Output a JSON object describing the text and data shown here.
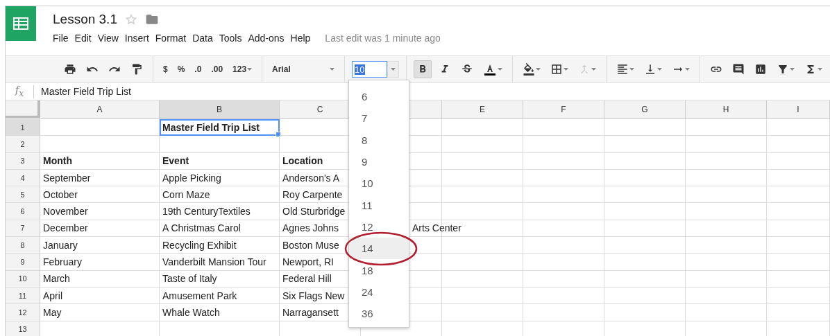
{
  "document": {
    "title": "Lesson 3.1",
    "starred": false,
    "last_edit": "Last edit was 1 minute ago"
  },
  "menu": [
    "File",
    "Edit",
    "View",
    "Insert",
    "Format",
    "Data",
    "Tools",
    "Add-ons",
    "Help"
  ],
  "toolbar": {
    "groups": [
      [
        {
          "kind": "print"
        },
        {
          "kind": "undo"
        },
        {
          "kind": "redo"
        },
        {
          "kind": "paint-format"
        }
      ],
      [
        {
          "kind": "text",
          "label": "$"
        },
        {
          "kind": "text",
          "label": "%"
        },
        {
          "kind": "decrease-decimals",
          "label": ".0"
        },
        {
          "kind": "increase-decimals",
          "label": ".00"
        },
        {
          "kind": "text",
          "label": "123",
          "caret": true
        }
      ],
      [
        {
          "kind": "font",
          "label": "Arial"
        }
      ],
      [
        {
          "kind": "font-size",
          "value": "10"
        }
      ],
      [
        {
          "kind": "bold",
          "active": true
        },
        {
          "kind": "italic"
        },
        {
          "kind": "strikethrough"
        },
        {
          "kind": "text-color",
          "caret": true
        }
      ],
      [
        {
          "kind": "fill-color",
          "caret": true
        },
        {
          "kind": "borders",
          "caret": true
        },
        {
          "kind": "merge",
          "caret": true,
          "disabled": true
        }
      ],
      [
        {
          "kind": "align",
          "caret": true
        },
        {
          "kind": "valign",
          "caret": true
        },
        {
          "kind": "wrap",
          "caret": true
        }
      ],
      [
        {
          "kind": "link"
        },
        {
          "kind": "comment"
        },
        {
          "kind": "chart"
        },
        {
          "kind": "filter",
          "caret": true
        },
        {
          "kind": "functions",
          "caret": true
        }
      ]
    ]
  },
  "formula_bar": {
    "label": "f$_{x}$",
    "value": "Master Field Trip List"
  },
  "font_size_menu": [
    {
      "label": "6",
      "selected": false
    },
    {
      "label": "7",
      "selected": false
    },
    {
      "label": "8",
      "selected": false
    },
    {
      "label": "9",
      "selected": false
    },
    {
      "label": "10",
      "selected": false
    },
    {
      "label": "11",
      "selected": false
    },
    {
      "label": "12",
      "selected": false
    },
    {
      "label": "14",
      "selected": true
    },
    {
      "label": "18",
      "selected": false
    },
    {
      "label": "24",
      "selected": false
    },
    {
      "label": "36",
      "selected": false
    }
  ],
  "sheet": {
    "columns": [
      {
        "label": "A",
        "selected": false
      },
      {
        "label": "B",
        "selected": true
      },
      {
        "label": "C",
        "selected": false
      },
      {
        "selected": false
      },
      {
        "label": "E",
        "selected": false
      },
      {
        "label": "F",
        "selected": false
      },
      {
        "label": "G",
        "selected": false
      },
      {
        "label": "H",
        "selected": false
      },
      {
        "label": "I",
        "selected": false
      }
    ],
    "rows": [
      {
        "label": "1",
        "selected": true,
        "bold": true,
        "cells": [
          "",
          "Master Field Trip List",
          "",
          ""
        ]
      },
      {
        "label": "2",
        "selected": false,
        "cells": []
      },
      {
        "label": "3",
        "selected": false,
        "bold": true,
        "cells": [
          "Month",
          "Event",
          "Location",
          ""
        ]
      },
      {
        "label": "4",
        "selected": false,
        "bold": false,
        "cells": [
          "September",
          "Apple Picking",
          "Anderson's A",
          ""
        ]
      },
      {
        "label": "5",
        "selected": false,
        "bold": false,
        "cells": [
          "October",
          "Corn Maze",
          "Roy Carpente",
          ""
        ]
      },
      {
        "label": "6",
        "selected": false,
        "bold": false,
        "cells": [
          "November",
          "19th CenturyTextiles",
          "Old Sturbridge",
          ""
        ]
      },
      {
        "label": "7",
        "selected": false,
        "bold": false,
        "cells": [
          "December",
          "A Christmas Carol",
          "Agnes Johns",
          "Arts Center"
        ]
      },
      {
        "label": "8",
        "selected": false,
        "bold": false,
        "cells": [
          "January",
          "Recycling Exhibit",
          "Boston Muse",
          ""
        ]
      },
      {
        "label": "9",
        "selected": false,
        "bold": false,
        "cells": [
          "February",
          "Vanderbilt Mansion Tour",
          "Newport, RI",
          ""
        ]
      },
      {
        "label": "10",
        "selected": false,
        "bold": false,
        "cells": [
          "March",
          "Taste of Italy",
          "Federal Hill",
          ""
        ]
      },
      {
        "label": "11",
        "selected": false,
        "bold": false,
        "cells": [
          "April",
          "Amusement Park",
          "Six Flags New",
          ""
        ]
      },
      {
        "label": "12",
        "selected": false,
        "bold": false,
        "cells": [
          "May",
          "Whale Watch",
          "Narragansett",
          ""
        ]
      },
      {
        "label": "13",
        "selected": false,
        "cells": []
      }
    ]
  }
}
